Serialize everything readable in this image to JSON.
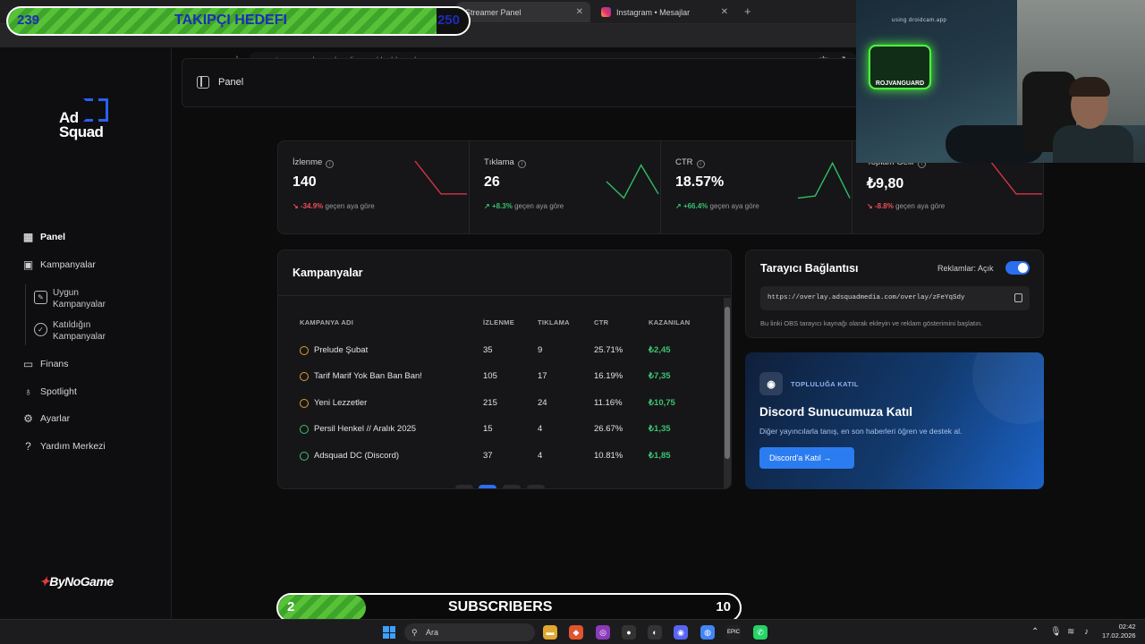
{
  "browser": {
    "tabs": [
      {
        "label": "Streamer Panel"
      },
      {
        "label": "Instagram • Mesajlar"
      }
    ],
    "url": "streamer.adsquadmedia.com/dashboard"
  },
  "sidebar": {
    "logo_line1": "Ad",
    "logo_line2": "Squad",
    "items": [
      {
        "label": "Panel",
        "icon": "grid-icon",
        "active": true
      },
      {
        "label": "Kampanyalar",
        "icon": "briefcase-icon"
      },
      {
        "label": "Uygun\nKampanyalar",
        "icon": "edit-icon"
      },
      {
        "label": "Katıldığın\nKampanyalar",
        "icon": "check-circle-icon"
      },
      {
        "label": "Finans",
        "icon": "wallet-icon"
      },
      {
        "label": "Spotlight",
        "icon": "bulb-icon"
      },
      {
        "label": "Ayarlar",
        "icon": "gear-icon"
      },
      {
        "label": "Yardım Merkezi",
        "icon": "help-icon"
      }
    ],
    "sponsor": "ByNoGame"
  },
  "header": {
    "title": "Panel"
  },
  "stats": [
    {
      "label": "İzlenme",
      "value": "140",
      "change": "-34.9%",
      "suffix": "geçen aya göre",
      "trend": "down",
      "spark": [
        1.0,
        0.2,
        0.2
      ]
    },
    {
      "label": "Tıklama",
      "value": "26",
      "change": "+8.3%",
      "suffix": "geçen aya göre",
      "trend": "up",
      "spark": [
        0.5,
        0.1,
        0.9,
        0.2
      ]
    },
    {
      "label": "CTR",
      "value": "18.57%",
      "change": "+66.4%",
      "suffix": "geçen aya göre",
      "trend": "up",
      "spark": [
        0.1,
        0.15,
        0.95,
        0.1
      ]
    },
    {
      "label": "Toplam Gelir",
      "value": "₺9,80",
      "change": "-8.8%",
      "suffix": "geçen aya göre",
      "trend": "down",
      "spark": [
        1.0,
        0.2,
        0.2
      ]
    }
  ],
  "campaigns": {
    "title": "Kampanyalar",
    "headers": [
      "KAMPANYA ADI",
      "İZLENME",
      "TIKLAMA",
      "CTR",
      "KAZANILAN"
    ],
    "rows": [
      {
        "status": "pending",
        "name": "Prelude Şubat",
        "views": "35",
        "clicks": "9",
        "ctr": "25.71%",
        "earned": "₺2,45"
      },
      {
        "status": "pending",
        "name": "Tarif Marif Yok Ban Ban Ban!",
        "views": "105",
        "clicks": "17",
        "ctr": "16.19%",
        "earned": "₺7,35"
      },
      {
        "status": "pending",
        "name": "Yeni Lezzetler",
        "views": "215",
        "clicks": "24",
        "ctr": "11.16%",
        "earned": "₺10,75"
      },
      {
        "status": "done",
        "name": "Persil Henkel // Aralık 2025",
        "views": "15",
        "clicks": "4",
        "ctr": "26.67%",
        "earned": "₺1,35"
      },
      {
        "status": "done",
        "name": "Adsquad DC (Discord)",
        "views": "37",
        "clicks": "4",
        "ctr": "10.81%",
        "earned": "₺1,85"
      }
    ]
  },
  "connection": {
    "title": "Tarayıcı Bağlantısı",
    "ads_label": "Reklamlar: Açık",
    "ads_on": true,
    "url": "https://overlay.adsquadmedia.com/overlay/zFeYqSdy",
    "help": "Bu linki OBS tarayıcı kaynağı olarak ekleyin ve reklam gösterimini başlatın."
  },
  "discord": {
    "tag": "TOPLULUĞA KATIL",
    "title": "Discord Sunucumuza Katıl",
    "desc": "Diğer yayıncılarla tanış, en son haberleri öğren ve destek al.",
    "button": "Discord'a Katıl"
  },
  "overlays": {
    "follow": {
      "current": "239",
      "label": "TAKIPÇI HEDEFI",
      "goal": "250"
    },
    "subs": {
      "current": "2",
      "label": "SUBSCRIBERS",
      "goal": "10"
    },
    "webcam_sign": "ROJVANGUARD",
    "webcam_stamp": "using droidcam.app"
  },
  "taskbar": {
    "search": "Ara",
    "time": "02:42",
    "date": "17.02.2026"
  }
}
